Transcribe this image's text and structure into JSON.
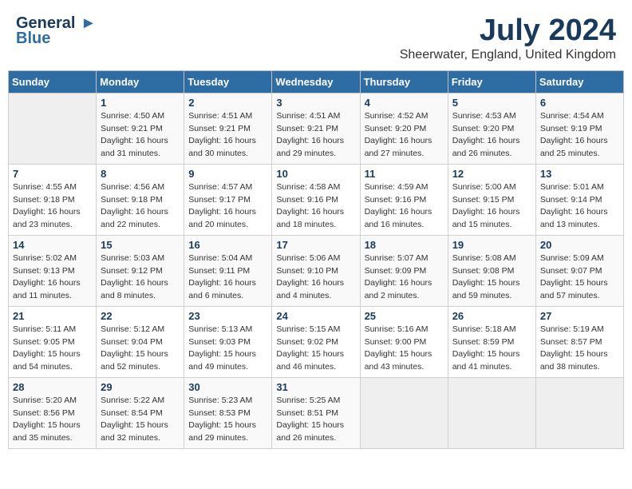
{
  "logo": {
    "line1": "General",
    "line2": "Blue"
  },
  "title": "July 2024",
  "subtitle": "Sheerwater, England, United Kingdom",
  "days_of_week": [
    "Sunday",
    "Monday",
    "Tuesday",
    "Wednesday",
    "Thursday",
    "Friday",
    "Saturday"
  ],
  "weeks": [
    [
      {
        "day": "",
        "info": []
      },
      {
        "day": "1",
        "info": [
          "Sunrise: 4:50 AM",
          "Sunset: 9:21 PM",
          "Daylight: 16 hours",
          "and 31 minutes."
        ]
      },
      {
        "day": "2",
        "info": [
          "Sunrise: 4:51 AM",
          "Sunset: 9:21 PM",
          "Daylight: 16 hours",
          "and 30 minutes."
        ]
      },
      {
        "day": "3",
        "info": [
          "Sunrise: 4:51 AM",
          "Sunset: 9:21 PM",
          "Daylight: 16 hours",
          "and 29 minutes."
        ]
      },
      {
        "day": "4",
        "info": [
          "Sunrise: 4:52 AM",
          "Sunset: 9:20 PM",
          "Daylight: 16 hours",
          "and 27 minutes."
        ]
      },
      {
        "day": "5",
        "info": [
          "Sunrise: 4:53 AM",
          "Sunset: 9:20 PM",
          "Daylight: 16 hours",
          "and 26 minutes."
        ]
      },
      {
        "day": "6",
        "info": [
          "Sunrise: 4:54 AM",
          "Sunset: 9:19 PM",
          "Daylight: 16 hours",
          "and 25 minutes."
        ]
      }
    ],
    [
      {
        "day": "7",
        "info": [
          "Sunrise: 4:55 AM",
          "Sunset: 9:18 PM",
          "Daylight: 16 hours",
          "and 23 minutes."
        ]
      },
      {
        "day": "8",
        "info": [
          "Sunrise: 4:56 AM",
          "Sunset: 9:18 PM",
          "Daylight: 16 hours",
          "and 22 minutes."
        ]
      },
      {
        "day": "9",
        "info": [
          "Sunrise: 4:57 AM",
          "Sunset: 9:17 PM",
          "Daylight: 16 hours",
          "and 20 minutes."
        ]
      },
      {
        "day": "10",
        "info": [
          "Sunrise: 4:58 AM",
          "Sunset: 9:16 PM",
          "Daylight: 16 hours",
          "and 18 minutes."
        ]
      },
      {
        "day": "11",
        "info": [
          "Sunrise: 4:59 AM",
          "Sunset: 9:16 PM",
          "Daylight: 16 hours",
          "and 16 minutes."
        ]
      },
      {
        "day": "12",
        "info": [
          "Sunrise: 5:00 AM",
          "Sunset: 9:15 PM",
          "Daylight: 16 hours",
          "and 15 minutes."
        ]
      },
      {
        "day": "13",
        "info": [
          "Sunrise: 5:01 AM",
          "Sunset: 9:14 PM",
          "Daylight: 16 hours",
          "and 13 minutes."
        ]
      }
    ],
    [
      {
        "day": "14",
        "info": [
          "Sunrise: 5:02 AM",
          "Sunset: 9:13 PM",
          "Daylight: 16 hours",
          "and 11 minutes."
        ]
      },
      {
        "day": "15",
        "info": [
          "Sunrise: 5:03 AM",
          "Sunset: 9:12 PM",
          "Daylight: 16 hours",
          "and 8 minutes."
        ]
      },
      {
        "day": "16",
        "info": [
          "Sunrise: 5:04 AM",
          "Sunset: 9:11 PM",
          "Daylight: 16 hours",
          "and 6 minutes."
        ]
      },
      {
        "day": "17",
        "info": [
          "Sunrise: 5:06 AM",
          "Sunset: 9:10 PM",
          "Daylight: 16 hours",
          "and 4 minutes."
        ]
      },
      {
        "day": "18",
        "info": [
          "Sunrise: 5:07 AM",
          "Sunset: 9:09 PM",
          "Daylight: 16 hours",
          "and 2 minutes."
        ]
      },
      {
        "day": "19",
        "info": [
          "Sunrise: 5:08 AM",
          "Sunset: 9:08 PM",
          "Daylight: 15 hours",
          "and 59 minutes."
        ]
      },
      {
        "day": "20",
        "info": [
          "Sunrise: 5:09 AM",
          "Sunset: 9:07 PM",
          "Daylight: 15 hours",
          "and 57 minutes."
        ]
      }
    ],
    [
      {
        "day": "21",
        "info": [
          "Sunrise: 5:11 AM",
          "Sunset: 9:05 PM",
          "Daylight: 15 hours",
          "and 54 minutes."
        ]
      },
      {
        "day": "22",
        "info": [
          "Sunrise: 5:12 AM",
          "Sunset: 9:04 PM",
          "Daylight: 15 hours",
          "and 52 minutes."
        ]
      },
      {
        "day": "23",
        "info": [
          "Sunrise: 5:13 AM",
          "Sunset: 9:03 PM",
          "Daylight: 15 hours",
          "and 49 minutes."
        ]
      },
      {
        "day": "24",
        "info": [
          "Sunrise: 5:15 AM",
          "Sunset: 9:02 PM",
          "Daylight: 15 hours",
          "and 46 minutes."
        ]
      },
      {
        "day": "25",
        "info": [
          "Sunrise: 5:16 AM",
          "Sunset: 9:00 PM",
          "Daylight: 15 hours",
          "and 43 minutes."
        ]
      },
      {
        "day": "26",
        "info": [
          "Sunrise: 5:18 AM",
          "Sunset: 8:59 PM",
          "Daylight: 15 hours",
          "and 41 minutes."
        ]
      },
      {
        "day": "27",
        "info": [
          "Sunrise: 5:19 AM",
          "Sunset: 8:57 PM",
          "Daylight: 15 hours",
          "and 38 minutes."
        ]
      }
    ],
    [
      {
        "day": "28",
        "info": [
          "Sunrise: 5:20 AM",
          "Sunset: 8:56 PM",
          "Daylight: 15 hours",
          "and 35 minutes."
        ]
      },
      {
        "day": "29",
        "info": [
          "Sunrise: 5:22 AM",
          "Sunset: 8:54 PM",
          "Daylight: 15 hours",
          "and 32 minutes."
        ]
      },
      {
        "day": "30",
        "info": [
          "Sunrise: 5:23 AM",
          "Sunset: 8:53 PM",
          "Daylight: 15 hours",
          "and 29 minutes."
        ]
      },
      {
        "day": "31",
        "info": [
          "Sunrise: 5:25 AM",
          "Sunset: 8:51 PM",
          "Daylight: 15 hours",
          "and 26 minutes."
        ]
      },
      {
        "day": "",
        "info": []
      },
      {
        "day": "",
        "info": []
      },
      {
        "day": "",
        "info": []
      }
    ]
  ]
}
